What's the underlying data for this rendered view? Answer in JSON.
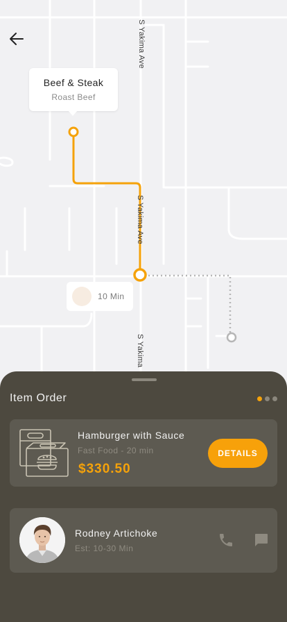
{
  "map": {
    "streets": [
      "S Yakima Ave",
      "S Yakima Ave",
      "S Yakima"
    ],
    "restaurant": {
      "name": "Beef & Steak",
      "item": "Roast Beef"
    },
    "eta": "10 Min"
  },
  "sheet": {
    "title": "Item Order",
    "pager": {
      "pages": 3,
      "active": 1
    },
    "order": {
      "name": "Hamburger with Sauce",
      "meta": "Fast Food - 20 min",
      "price": "$330.50",
      "details_label": "DETAILS"
    },
    "courier": {
      "name": "Rodney Artichoke",
      "eta": "Est: 10-30 Min"
    }
  },
  "colors": {
    "accent": "#f5a20a",
    "sheet": "#4d493f",
    "card": "#5d5a51",
    "road": "#dfdfe3",
    "route_pending": "#b6b6b6"
  },
  "icons": [
    "back-arrow-icon",
    "food-box-icon",
    "phone-icon",
    "chat-icon"
  ]
}
